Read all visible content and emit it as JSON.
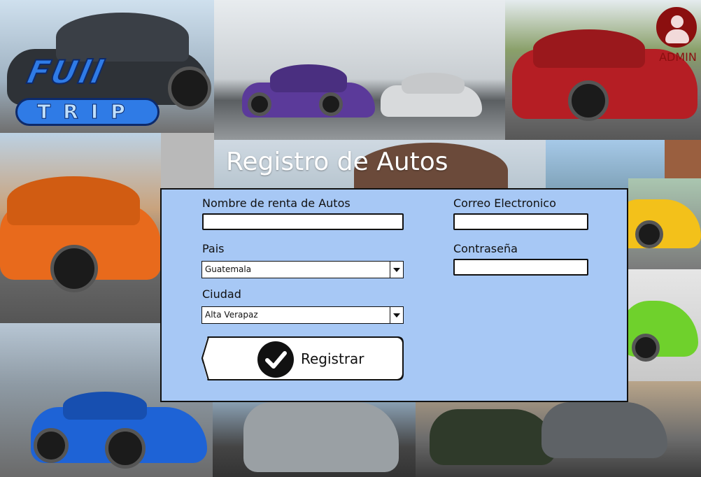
{
  "logo": {
    "line1": "FUll",
    "line2": "TRIP"
  },
  "admin": {
    "label": "ADMIN",
    "icon": "user-icon"
  },
  "page": {
    "title": "Registro de Autos"
  },
  "form": {
    "nombre_label": "Nombre de renta de Autos",
    "nombre_value": "",
    "pais_label": "Pais",
    "pais_value": "Guatemala",
    "ciudad_label": "Ciudad",
    "ciudad_value": "Alta Verapaz",
    "correo_label": "Correo Electronico",
    "correo_value": "",
    "contrasena_label": "Contraseña",
    "contrasena_value": "",
    "submit_label": "Registrar",
    "submit_icon": "checkmark-icon"
  },
  "colors": {
    "panel": "#a7c8f5",
    "logo_blue": "#2f7be6",
    "admin_red": "#8b0f0f"
  }
}
